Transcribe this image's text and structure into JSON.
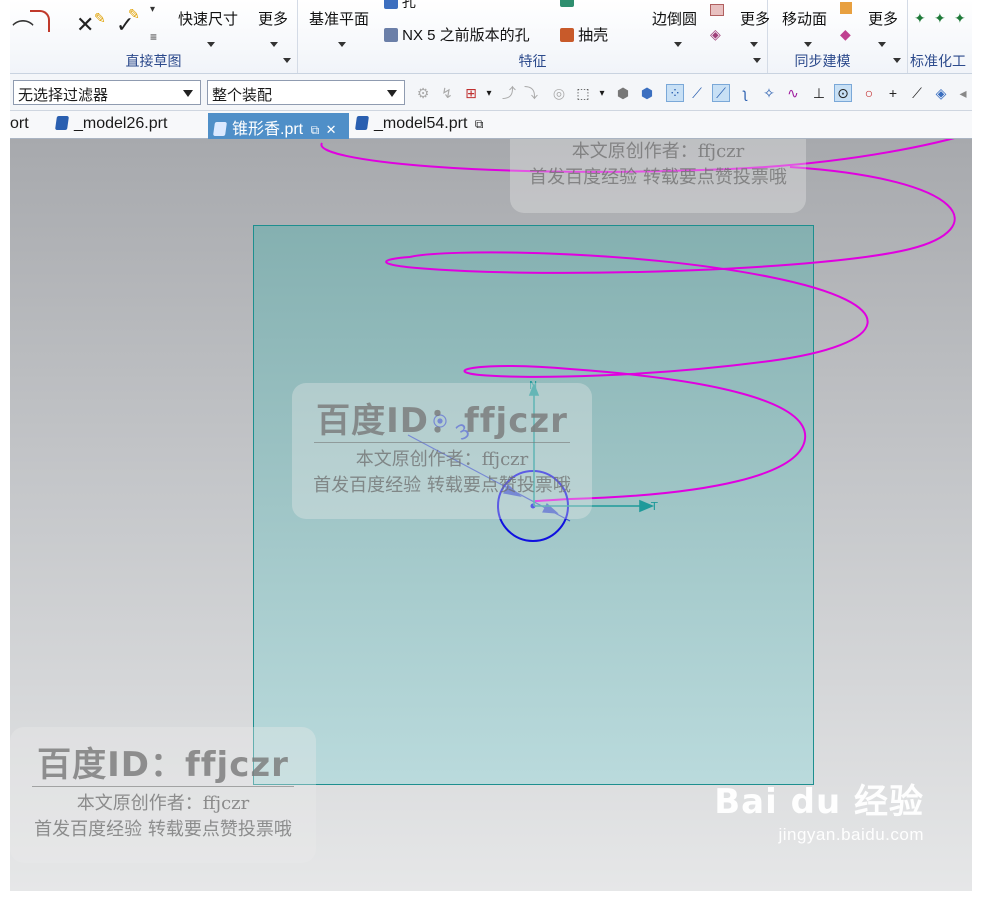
{
  "ribbon": {
    "groups": [
      {
        "label": "直接草图"
      },
      {
        "label": "特征"
      },
      {
        "label": "同步建模"
      },
      {
        "label": "标准化工"
      }
    ],
    "buttons": {
      "quick_dimension": "快速尺寸",
      "more_1": "更多",
      "datum_plane": "基准平面",
      "hole": "孔",
      "nx5_hole": "NX 5 之前版本的孔",
      "shell": "抽壳",
      "edge_blend": "边倒圆",
      "more_2": "更多",
      "move_face": "移动面",
      "more_3": "更多"
    }
  },
  "selection_bar": {
    "filter": "无选择过滤器",
    "scope": "整个装配"
  },
  "tabs": [
    {
      "label": "ort"
    },
    {
      "label": "_model26.prt"
    },
    {
      "label": "锥形香.prt",
      "active": true
    },
    {
      "label": "_model54.prt"
    }
  ],
  "triad": {
    "n_label": "N",
    "t_label": "T"
  },
  "dimension_label": "3",
  "watermark": {
    "line1": "百度ID：ffjczr",
    "line2": "本文原创作者：ffjczr",
    "line3": "首发百度经验 转载要点赞投票哦"
  },
  "baidu": {
    "logo": "Bai du 经验",
    "url": "jingyan.baidu.com"
  },
  "colors": {
    "helix": "#e000e0",
    "circle": "#1010e0",
    "plane_border": "#1e8f8f",
    "triad": "#1e9a9a",
    "ribbon_label": "#2c4a8c",
    "active_tab": "#4f8fc8"
  }
}
